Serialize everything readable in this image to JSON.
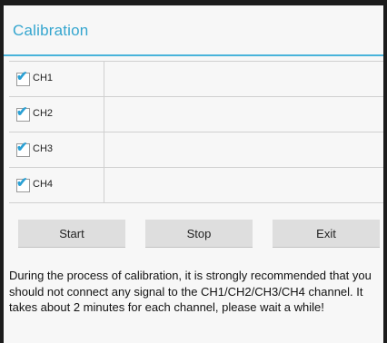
{
  "dialog": {
    "title": "Calibration"
  },
  "channels": [
    {
      "label": "CH1",
      "checked": true
    },
    {
      "label": "CH2",
      "checked": true
    },
    {
      "label": "CH3",
      "checked": true
    },
    {
      "label": "CH4",
      "checked": true
    }
  ],
  "buttons": {
    "start_label": "Start",
    "stop_label": "Stop",
    "exit_label": "Exit"
  },
  "message": "During the process of calibration, it is strongly recommended that you should not connect any signal to the CH1/CH2/CH3/CH4 channel. It takes about 2 minutes for each channel, please wait a while!",
  "checkbox_glyph": "✔",
  "colors": {
    "accent": "#35a6cf",
    "divider": "#48b3da",
    "check": "#2aa0d4",
    "button_bg": "#dedede"
  },
  "icons": {
    "checkbox": "checkbox-checked-icon"
  }
}
